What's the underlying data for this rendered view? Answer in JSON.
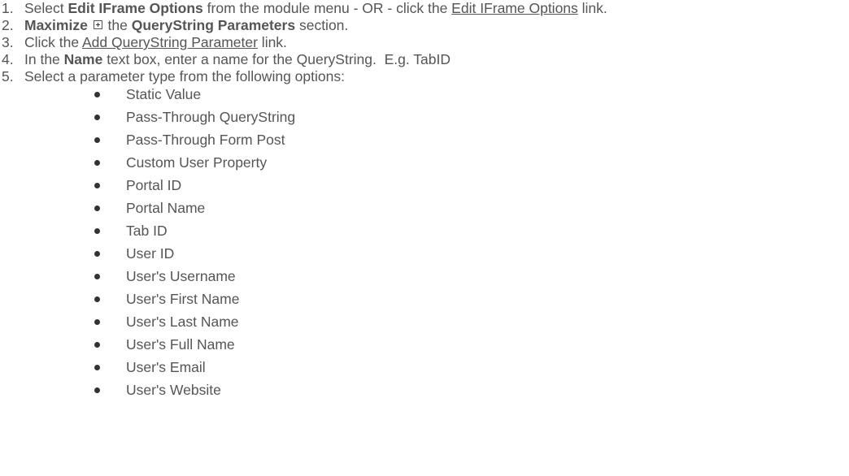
{
  "steps": [
    {
      "num": "1.",
      "text_a": "Select ",
      "bold_a": "Edit IFrame Options",
      "text_b": " from the module menu - OR - click the ",
      "link": "Edit IFrame Options",
      "text_c": " link."
    },
    {
      "num": "2.",
      "bold_a": "Maximize",
      "icon": "plus-box-icon",
      "text_b": " the ",
      "bold_b": "QueryString Parameters",
      "text_c": " section."
    },
    {
      "num": "3.",
      "text_a": "Click the ",
      "link": "Add QueryString Parameter",
      "text_b": " link."
    },
    {
      "num": "4.",
      "text_a": "In the ",
      "bold_a": "Name",
      "text_b": " text box, enter a name for the QueryString.  E.g. TabID"
    },
    {
      "num": "5.",
      "text_a": "Select a parameter type from the following options:"
    }
  ],
  "options": [
    "Static Value",
    "Pass-Through QueryString",
    "Pass-Through Form Post",
    "Custom User Property",
    "Portal ID",
    "Portal Name",
    "Tab ID",
    "User ID",
    "User's Username",
    "User's First Name",
    "User's Last Name",
    "User's Full Name",
    "User's Email",
    "User's Website"
  ]
}
